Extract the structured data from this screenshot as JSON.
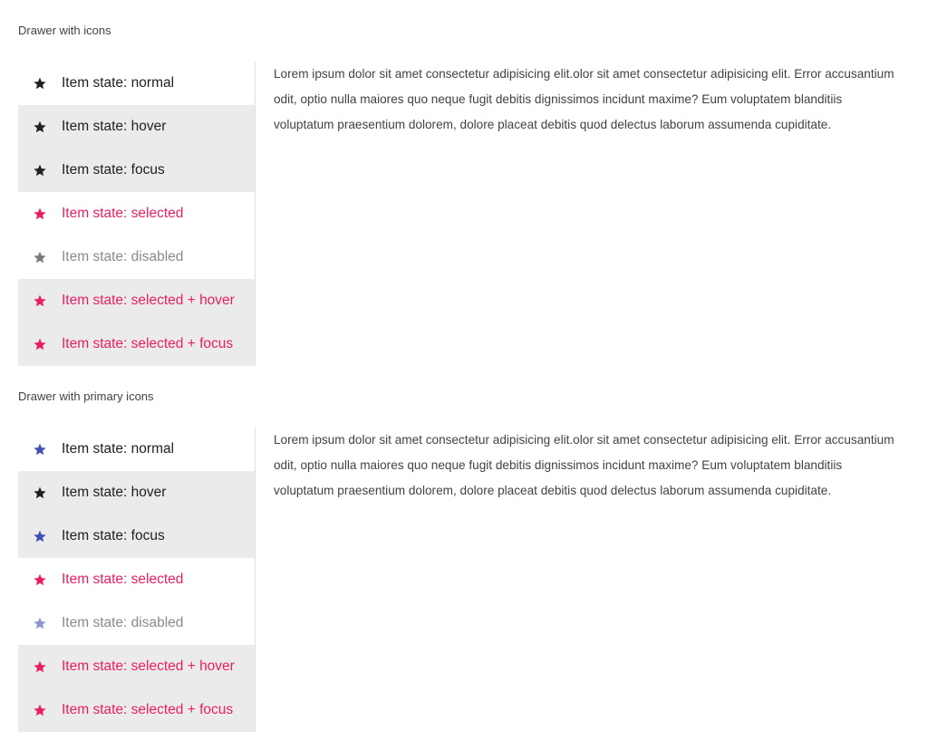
{
  "colors": {
    "text": "#212121",
    "selected": "#e91e63",
    "disabled": "#8a8a8a",
    "primary": "#3f51b5",
    "primary_disabled": "#8c96d3",
    "icon_default": "#212121",
    "icon_disabled": "#7a7a7a",
    "state_bg": "#ebebeb"
  },
  "sections": [
    {
      "title": "Drawer with icons",
      "content": "Lorem ipsum dolor sit amet consectetur adipisicing elit.olor sit amet consectetur adipisicing elit. Error accusantium odit, optio nulla maiores quo neque fugit debitis dignissimos incidunt maxime? Eum voluptatem blanditiis voluptatum praesentium dolorem, dolore placeat debitis quod delectus laborum assumenda cupiditate.",
      "items": [
        {
          "label": "Item state: normal",
          "icon": "star-icon",
          "state": "normal",
          "icon_color": "#212121"
        },
        {
          "label": "Item state: hover",
          "icon": "star-icon",
          "state": "hover",
          "icon_color": "#212121"
        },
        {
          "label": "Item state: focus",
          "icon": "star-icon",
          "state": "focus",
          "icon_color": "#212121"
        },
        {
          "label": "Item state: selected",
          "icon": "star-icon",
          "state": "selected",
          "icon_color": "#e91e63"
        },
        {
          "label": "Item state: disabled",
          "icon": "star-icon",
          "state": "disabled",
          "icon_color": "#7a7a7a"
        },
        {
          "label": "Item state: selected + hover",
          "icon": "star-icon",
          "state": "selected-hover",
          "icon_color": "#e91e63"
        },
        {
          "label": "Item state: selected + focus",
          "icon": "star-icon",
          "state": "selected-focus",
          "icon_color": "#e91e63"
        }
      ]
    },
    {
      "title": "Drawer with primary icons",
      "content": "Lorem ipsum dolor sit amet consectetur adipisicing elit.olor sit amet consectetur adipisicing elit. Error accusantium odit, optio nulla maiores quo neque fugit debitis dignissimos incidunt maxime? Eum voluptatem blanditiis voluptatum praesentium dolorem, dolore placeat debitis quod delectus laborum assumenda cupiditate.",
      "items": [
        {
          "label": "Item state: normal",
          "icon": "star-icon",
          "state": "normal",
          "icon_color": "#3f51b5"
        },
        {
          "label": "Item state: hover",
          "icon": "star-icon",
          "state": "hover",
          "icon_color": "#212121"
        },
        {
          "label": "Item state: focus",
          "icon": "star-icon",
          "state": "focus",
          "icon_color": "#3f51b5"
        },
        {
          "label": "Item state: selected",
          "icon": "star-icon",
          "state": "selected",
          "icon_color": "#e91e63"
        },
        {
          "label": "Item state: disabled",
          "icon": "star-icon",
          "state": "disabled",
          "icon_color": "#8c96d3"
        },
        {
          "label": "Item state: selected + hover",
          "icon": "star-icon",
          "state": "selected-hover",
          "icon_color": "#e91e63"
        },
        {
          "label": "Item state: selected + focus",
          "icon": "star-icon",
          "state": "selected-focus",
          "icon_color": "#e91e63"
        }
      ]
    }
  ]
}
